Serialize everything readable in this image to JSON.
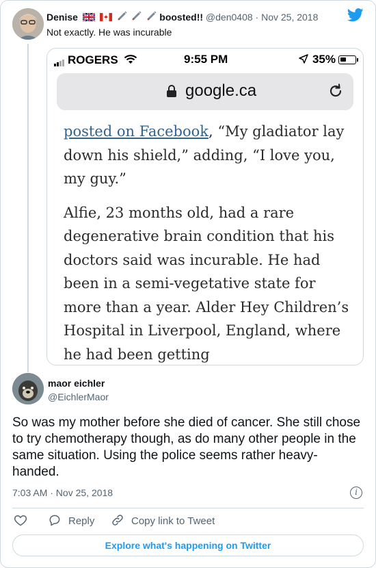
{
  "parent_tweet": {
    "display_name": "Denise",
    "name_suffix": "boosted!!",
    "handle": "@den0408",
    "separator": "·",
    "date": "Nov 25, 2018",
    "text": "Not exactly. He was incurable"
  },
  "embedded_screenshot": {
    "carrier": "ROGERS",
    "time": "9:55 PM",
    "battery": "35%",
    "url": "google.ca",
    "article": {
      "para1_link": "posted on Facebook",
      "para1_rest": ", “My gladiator lay down his shield,” adding, “I love you, my guy.”",
      "para2": "Alfie, 23 months old, had a rare degenerative brain condition that his doctors said was incurable. He had been in a semi-vegetative state for more than a year. Alder Hey Children’s Hospital in Liverpool, England, where he had been getting"
    }
  },
  "reply_tweet": {
    "display_name": "maor eichler",
    "handle": "@EichlerMaor",
    "text": "So was my mother before she died of cancer. She still chose to try chemotherapy though, as do many other people in the same situation. Using the police seems rather heavy-handed.",
    "timestamp": "7:03 AM · Nov 25, 2018",
    "actions": {
      "reply": "Reply",
      "copy_link": "Copy link to Tweet"
    },
    "explore": "Explore what's happening on Twitter"
  },
  "colors": {
    "accent": "#1d9bf0",
    "muted": "#536471",
    "border": "#cfd9de"
  }
}
